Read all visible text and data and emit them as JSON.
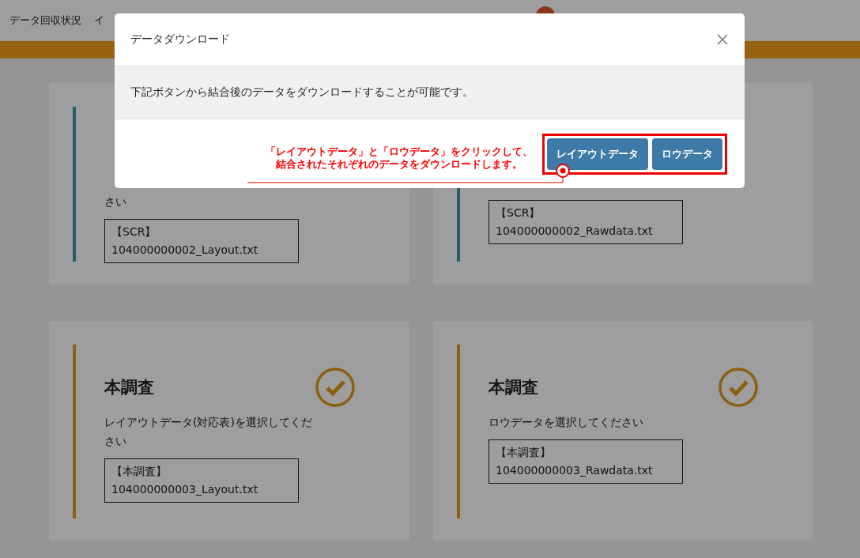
{
  "nav": {
    "items": [
      {
        "label": "データ回収状況"
      },
      {
        "label": "イ"
      }
    ]
  },
  "cards": [
    {
      "description_lines": [
        "さい"
      ],
      "file_lines": [
        "【SCR】104000000002_Layout.txt"
      ],
      "done": false
    },
    {
      "file_lines": [
        "【SCR】",
        "104000000002_Rawdata.txt"
      ],
      "done": false
    },
    {
      "title": "本調査",
      "description_lines": [
        "レイアウトデータ(対応表)を選択してくだ",
        "さい"
      ],
      "file_lines": [
        "【本調査】",
        "104000000003_Layout.txt"
      ],
      "done": true
    },
    {
      "title": "本調査",
      "description_lines": [
        "ロウデータを選択してください"
      ],
      "file_lines": [
        "【本調査】",
        "104000000003_Rawdata.txt"
      ],
      "done": true
    }
  ],
  "modal": {
    "title": "データダウンロード",
    "message": "下記ボタンから結合後のデータをダウンロードすることが可能です。",
    "annotation": [
      "「レイアウトデータ」と「ロウデータ」をクリックして、",
      "結合されたそれぞれのデータをダウンロードします。"
    ],
    "buttons": [
      "レイアウトデータ",
      "ロウデータ"
    ]
  }
}
